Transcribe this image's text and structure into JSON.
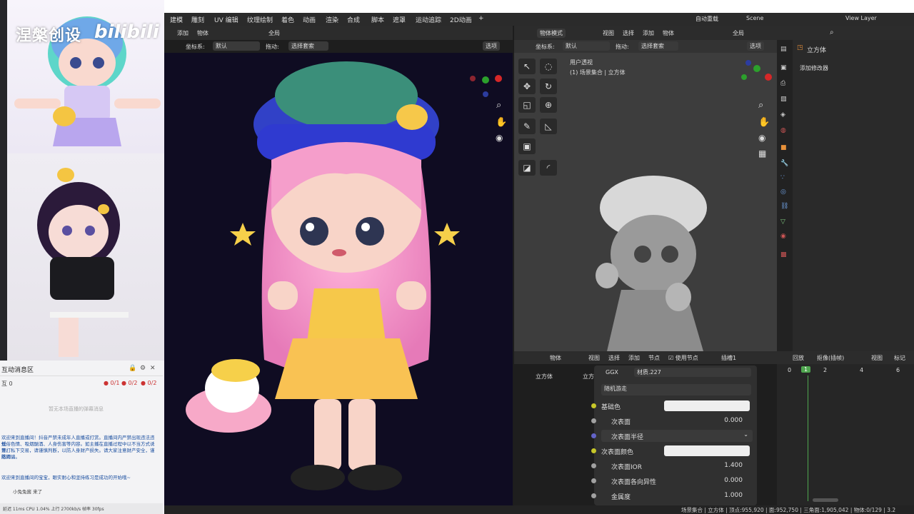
{
  "overlay": {
    "watermark": "涅槃创设",
    "logo": "bilibili",
    "chat": {
      "title": "互动消息区",
      "count_a": "0/1",
      "count_b": "0/2",
      "count_c": "0/2",
      "left_tag": "互 0",
      "placeholder": "暂无本场直播的弹幕消息",
      "messages": [
        "欢迎来到直播间！抖音严禁未成年人直播或打赏。直播间内严禁出现违法违规",
        "低俗色情、吸烟酗酒、人身伤害等内容。如主播在直播过程中以不当方式诱导打",
        "赏、私下交易，请谨慎判断，以防人身财产损失。请大家注意财产安全，谨防网",
        "络诈骗。"
      ],
      "welcome": "欢迎来到直播间的宝宝，眼实耐心和坚持练习是成功的开始哦~",
      "user_msg": "小兔兔酱 来了",
      "status": "延迟 11ms   CPU 1.04%   上行 2700kb/s   帧率 30fps"
    }
  },
  "menubar": {
    "items": [
      "建模",
      "雕刻",
      "UV 编辑",
      "纹理绘制",
      "着色",
      "动画",
      "渲染",
      "合成",
      "脚本",
      "遮罩",
      "运动追踪",
      "2D动画"
    ],
    "add_tab": "+",
    "auto_rig": "自动重载",
    "scene": "Scene",
    "view_layer": "View Layer"
  },
  "viewport1": {
    "menu": [
      "添加",
      "物体"
    ],
    "global": "全局",
    "coord_label": "坐标系:",
    "coord_value": "默认",
    "drag_label": "拖动:",
    "drag_value": "选择套索",
    "options": "选项"
  },
  "viewport2": {
    "mode": "物体模式",
    "menu": [
      "视图",
      "选择",
      "添加",
      "物体"
    ],
    "global": "全局",
    "coord_label": "坐标系:",
    "coord_value": "默认",
    "drag_label": "拖动:",
    "drag_value": "选择套索",
    "options": "选项",
    "view_name": "用户透视",
    "collection": "(1) 场景集合 | 立方体"
  },
  "properties": {
    "object": "立方体",
    "add_modifier": "添加修改器"
  },
  "node_editor": {
    "type": "物体",
    "menu": [
      "视图",
      "选择",
      "添加",
      "节点"
    ],
    "use_nodes": "使用节点",
    "slot": "插槽1",
    "breadcrumb_obj": "立方体",
    "breadcrumb_mesh": "立方体.2",
    "material": "材质.227",
    "ggx": "GGX",
    "random_walk": "随机游走",
    "rows": [
      {
        "label": "基础色",
        "value": "",
        "socket": "#c7c729",
        "kind": "color"
      },
      {
        "label": "次表面",
        "value": "0.000",
        "socket": "#a1a1a1",
        "kind": "num"
      },
      {
        "label": "次表面半径",
        "value": "",
        "socket": "#6363c7",
        "kind": "dropdown"
      },
      {
        "label": "次表面颜色",
        "value": "",
        "socket": "#c7c729",
        "kind": "color"
      },
      {
        "label": "次表面IOR",
        "value": "1.400",
        "socket": "#a1a1a1",
        "kind": "num"
      },
      {
        "label": "次表面各向异性",
        "value": "0.000",
        "socket": "#a1a1a1",
        "kind": "num"
      },
      {
        "label": "金属度",
        "value": "1.000",
        "socket": "#a1a1a1",
        "kind": "num"
      }
    ]
  },
  "timeline": {
    "menu": [
      "回放",
      "抠像(插帧)",
      "视图",
      "标记"
    ],
    "frames": [
      "0",
      "1",
      "2",
      "4",
      "6"
    ],
    "current": "1"
  },
  "statusbar": {
    "text": "场景集合 | 立方体 | 顶点:955,920 | 面:952,750 | 三角面:1,905,042 | 物体:0/129 | 3.2"
  },
  "colors": {
    "accent": "#4772b3",
    "current_frame": "#4fa64f",
    "viewport_bg": "#0f0c22"
  }
}
